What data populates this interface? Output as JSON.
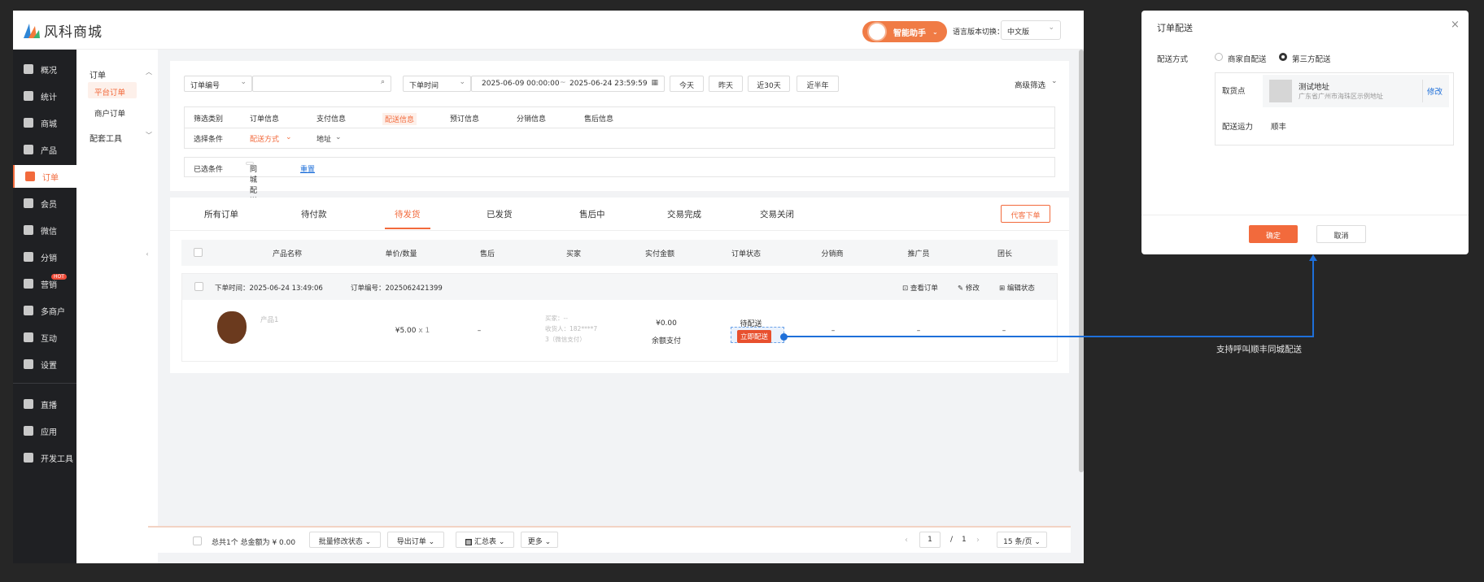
{
  "app": {
    "logo_text": "风科商城",
    "assistant_label": "智能助手",
    "lang_label": "语言版本切换：",
    "lang_value": "中文版"
  },
  "sidebar": {
    "items": [
      {
        "label": "概况",
        "icon": "overview-icon"
      },
      {
        "label": "统计",
        "icon": "chart-icon"
      },
      {
        "label": "商城",
        "icon": "store-icon"
      },
      {
        "label": "产品",
        "icon": "product-icon"
      },
      {
        "label": "订单",
        "icon": "order-icon"
      },
      {
        "label": "会员",
        "icon": "crown-icon"
      },
      {
        "label": "微信",
        "icon": "wechat-icon"
      },
      {
        "label": "分销",
        "icon": "distribution-icon"
      },
      {
        "label": "营销",
        "icon": "flag-icon",
        "badge": "HOT"
      },
      {
        "label": "多商户",
        "icon": "merchant-icon"
      },
      {
        "label": "互动",
        "icon": "interact-icon"
      },
      {
        "label": "设置",
        "icon": "gear-icon"
      },
      {
        "label": "直播",
        "icon": "live-icon"
      },
      {
        "label": "应用",
        "icon": "apps-icon"
      },
      {
        "label": "开发工具",
        "icon": "tools-icon"
      }
    ]
  },
  "submenu": {
    "group1": "订单",
    "item1": "平台订单",
    "item2": "商户订单",
    "group2": "配套工具"
  },
  "filters": {
    "order_field": "订单编号",
    "time_field": "下单时间",
    "date_start": "2025-06-09 00:00:00",
    "date_sep": "~",
    "date_end": "2025-06-24 23:59:59",
    "quick": [
      "今天",
      "昨天",
      "近30天",
      "近半年"
    ],
    "advanced": "高级筛选"
  },
  "conditions": {
    "category_label": "筛选类别",
    "categories": [
      "订单信息",
      "支付信息",
      "配送信息",
      "预订信息",
      "分销信息",
      "售后信息"
    ],
    "choose_label": "选择条件",
    "choose_1": "配送方式",
    "choose_2": "地址",
    "selected_label": "已选条件",
    "selected_tag": "同城配送",
    "reset": "重置"
  },
  "tabs": [
    "所有订单",
    "待付款",
    "待发货",
    "已发货",
    "售后中",
    "交易完成",
    "交易关闭"
  ],
  "proxy_button": "代客下单",
  "table": {
    "headers": [
      "产品名称",
      "单价/数量",
      "售后",
      "买家",
      "实付金额",
      "订单状态",
      "分销商",
      "推广员",
      "团长"
    ],
    "order_time": "下单时间：2025-06-24 13:49:06",
    "order_no": "订单编号：2025062421399",
    "actions": [
      "查看订单",
      "修改",
      "编辑状态"
    ],
    "row": {
      "product": "产品1",
      "price": "¥5.00",
      "qty": "x 1",
      "aftersale": "–",
      "buyer1": "买家：--",
      "buyer2": "收货人：182****7",
      "buyer3": "3（微信支付）",
      "paid": "¥0.00",
      "pay_method": "余额支付",
      "status": "待配送",
      "status_btn": "立即配送",
      "dist": "–",
      "promoter": "–",
      "leader": "–"
    }
  },
  "footer": {
    "summary": "总共1个  总金额为 ¥ 0.00",
    "batch": "批量修改状态",
    "export": "导出订单",
    "sum_table": "汇总表",
    "more": "更多",
    "page_current": "1",
    "page_sep": "/",
    "page_total": "1",
    "page_size": "15 条/页"
  },
  "dialog": {
    "title": "订单配送",
    "method_label": "配送方式",
    "opt1": "商家自配送",
    "opt2": "第三方配送",
    "pickup_label": "取货点",
    "pickup_name": "测试地址",
    "pickup_addr": "广东省广州市海珠区示例地址",
    "modify": "修改",
    "capacity_label": "配送运力",
    "capacity_value": "顺丰",
    "confirm": "确定",
    "cancel": "取消"
  },
  "annotation": "支持呼叫顺丰同城配送"
}
